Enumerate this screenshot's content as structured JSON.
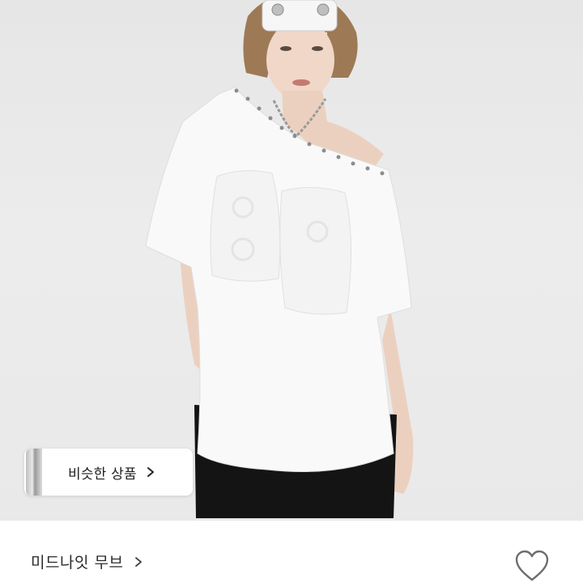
{
  "product": {
    "image_subject": "product-photo"
  },
  "similar": {
    "label": "비슷한 상품"
  },
  "shop": {
    "name": "미드나잇 무브"
  },
  "icons": {
    "chevron": "chevron-right-icon",
    "heart": "heart-outline-icon"
  },
  "colors": {
    "background": "#ffffff",
    "text": "#1e1e1e",
    "heart_stroke": "#6e6e6e"
  }
}
